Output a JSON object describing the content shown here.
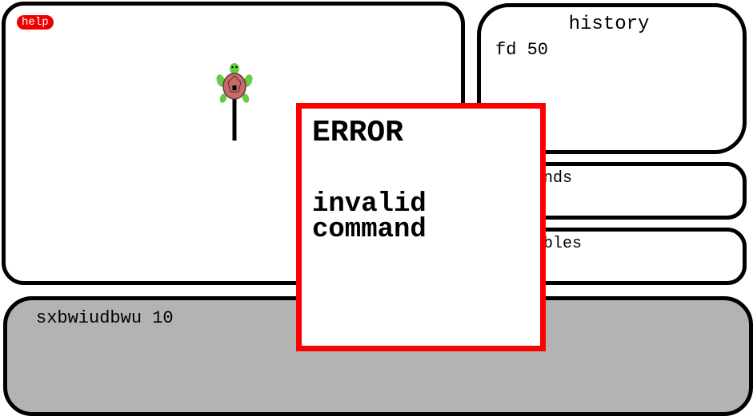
{
  "canvas": {
    "help_label": "help"
  },
  "history": {
    "title": "history",
    "entries": [
      "fd 50"
    ]
  },
  "commands": {
    "title": "commands"
  },
  "variables": {
    "title": "variables"
  },
  "input": {
    "value": "sxbwiudbwu 10"
  },
  "error": {
    "title": "ERROR",
    "message": "invalid command"
  },
  "colors": {
    "panel_border": "#000000",
    "input_background": "#b3b3b3",
    "help_button": "#ee0000",
    "error_border": "#ff0000",
    "turtle_shell": "#c86a6a",
    "turtle_skin": "#66cc44"
  },
  "icons": {
    "turtle": "turtle-icon"
  }
}
